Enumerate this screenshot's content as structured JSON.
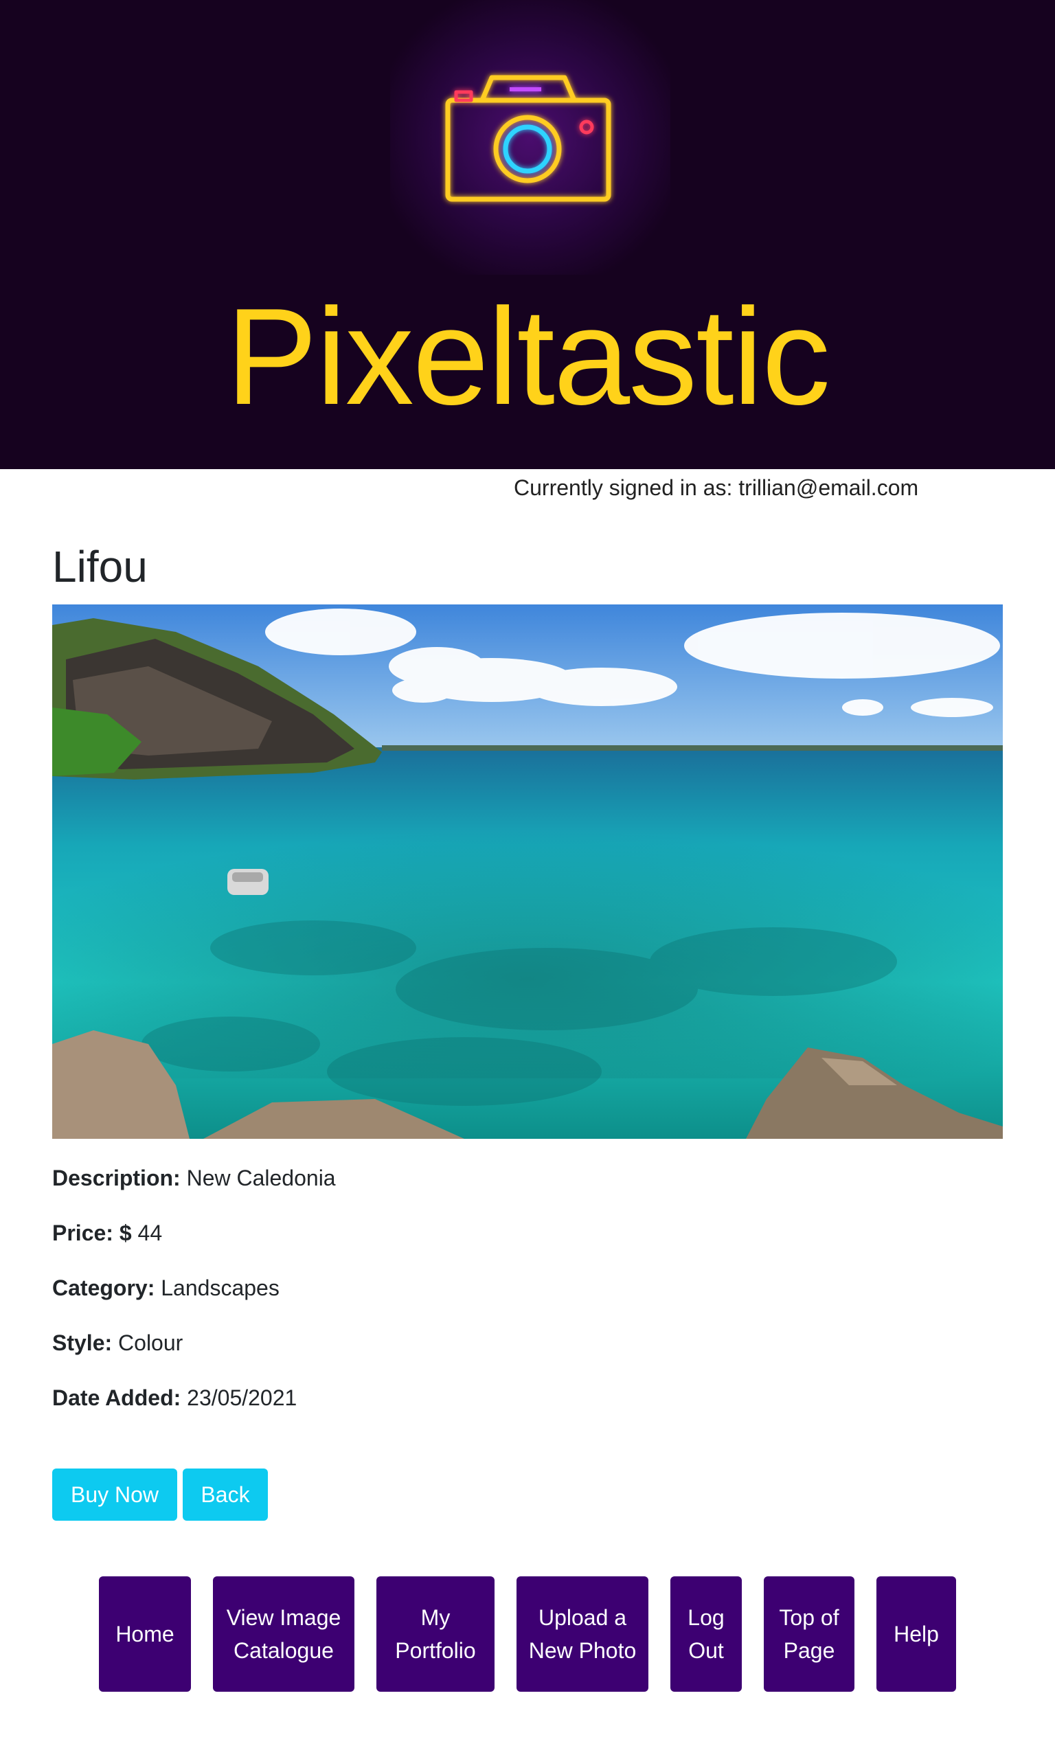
{
  "header": {
    "brand_name": "Pixeltastic",
    "logo_icon": "camera-icon",
    "colors": {
      "background": "#16021f",
      "brand": "#ffd21a"
    }
  },
  "user": {
    "signed_in_text": "Currently signed in as: trillian@email.com"
  },
  "photo": {
    "title": "Lifou",
    "description_label": "Description:",
    "description": "New Caledonia",
    "price_label": "Price: $",
    "price": "44",
    "category_label": "Category:",
    "category": "Landscapes",
    "style_label": "Style:",
    "style": "Colour",
    "date_label": "Date Added:",
    "date_added": "23/05/2021"
  },
  "actions": {
    "buy_label": "Buy Now",
    "back_label": "Back",
    "button_color": "#0dcaf0"
  },
  "nav": {
    "button_color": "#3d0072",
    "home": "Home",
    "catalogue": "View Image Catalogue",
    "portfolio": "My Portfolio",
    "upload": "Upload a New Photo",
    "logout": "Log Out",
    "top": "Top of Page",
    "help": "Help"
  }
}
